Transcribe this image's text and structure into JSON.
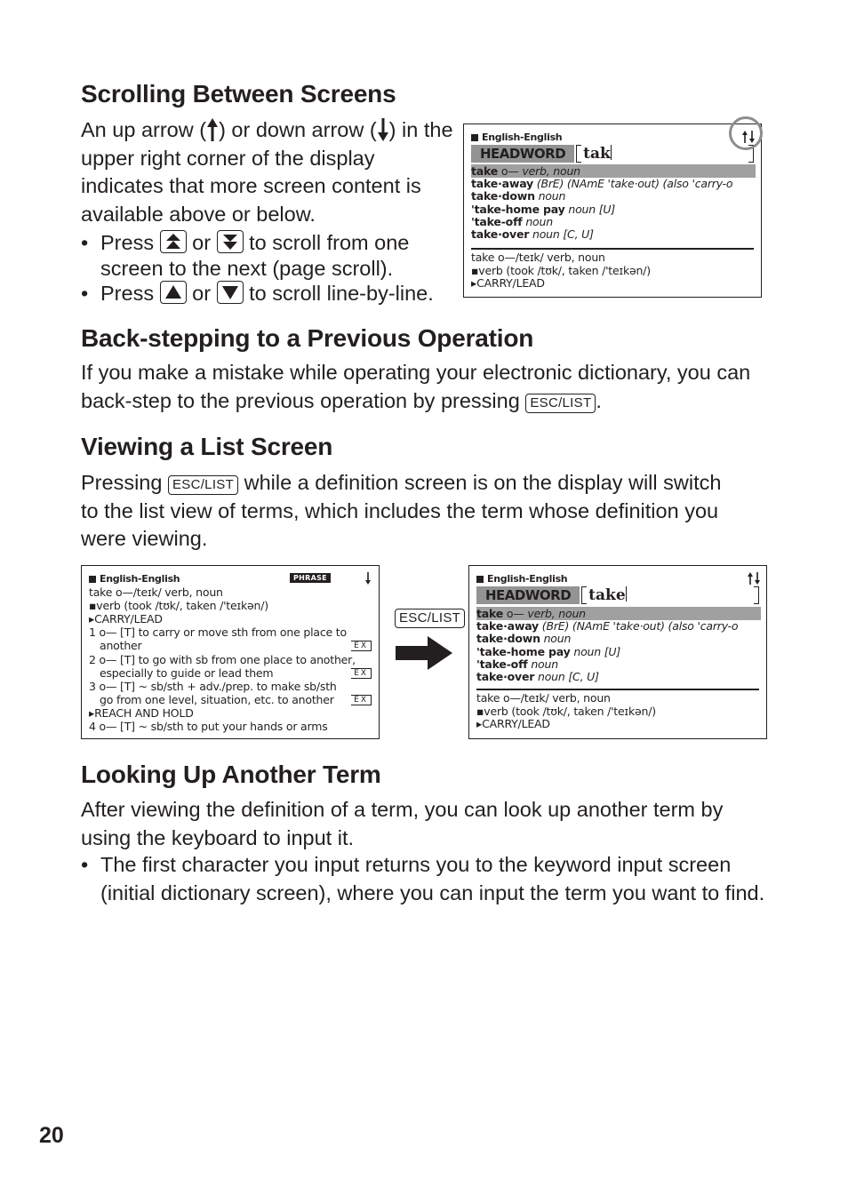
{
  "page_number": "20",
  "sections": {
    "scrolling": {
      "title": "Scrolling Between Screens",
      "para_parts": [
        "An up arrow (",
        ") or down arrow (",
        ") in the upper right corner of the display indicates that more screen content is available above or below."
      ],
      "bullets": [
        {
          "press": "Press",
          "or": "or",
          "text": "to scroll from one screen to the next (page scroll).",
          "keys": [
            "page-up-key",
            "page-down-key"
          ]
        },
        {
          "press": "Press",
          "or": "or",
          "text": "to scroll line-by-line.",
          "keys": [
            "up-key",
            "down-key"
          ]
        }
      ]
    },
    "backstep": {
      "title": "Back-stepping to a Previous Operation",
      "para_before": "If you make a mistake while operating your electronic dictionary, you can back-step to the previous operation by pressing",
      "para_after": "."
    },
    "list_screen": {
      "title": "Viewing a List Screen",
      "para_before": "Pressing",
      "para_after": "while a definition screen is on the display will switch to the list view of terms, which includes the term whose definition you were viewing."
    },
    "lookup": {
      "title": "Looking Up Another Term",
      "para": "After viewing the definition of a term, you can look up another term by using the keyboard to input it.",
      "bullet": "The first character you input returns you to the keyword input screen (initial dictionary screen), where you can input the term you want to find."
    }
  },
  "keys": {
    "esc_list": "ESC/LIST"
  },
  "screens": {
    "list1": {
      "header": "English-English",
      "headword_label": "HEADWORD",
      "input_value": "tak",
      "list": [
        {
          "head": "take",
          "key": "o—",
          "rest": "verb, noun",
          "selected": true
        },
        {
          "head": "take·away",
          "rest": "(BrE) (NAmE 'take·out) (also 'carry-o"
        },
        {
          "head": "take·down",
          "rest": "noun"
        },
        {
          "head": "'take-home pay",
          "rest": "noun [U]"
        },
        {
          "head": "'take-off",
          "rest": "noun"
        },
        {
          "head": "take·over",
          "rest": "noun [C, U]"
        }
      ],
      "preview": [
        "take o—/teɪk/ verb, noun",
        "▪verb (took /tʊk/, taken /'teɪkən/)",
        "▸CARRY/LEAD"
      ]
    },
    "definition": {
      "header": "English-English",
      "badge": "PHRASE",
      "lines": [
        "take o—/teɪk/ verb, noun",
        "▪verb (took /tʊk/, taken /'teɪkən/)",
        "▸CARRY/LEAD",
        "1 o— [T] to carry or move sth from one place to",
        "another",
        "2 o— [T] to go with sb from one place to another,",
        "especially to guide or lead them",
        "3 o— [T] ~ sb/sth + adv./prep. to make sb/sth",
        "go from one level, situation, etc. to another",
        "▸REACH AND HOLD",
        "4 o— [T] ~ sb/sth to put your hands or arms"
      ],
      "ex_label": "EX"
    },
    "list2": {
      "header": "English-English",
      "headword_label": "HEADWORD",
      "input_value": "take",
      "list": [
        {
          "head": "take",
          "key": "o—",
          "rest": "verb, noun",
          "selected": true
        },
        {
          "head": "take·away",
          "rest": "(BrE) (NAmE 'take·out) (also 'carry-o"
        },
        {
          "head": "take·down",
          "rest": "noun"
        },
        {
          "head": "'take-home pay",
          "rest": "noun [U]"
        },
        {
          "head": "'take-off",
          "rest": "noun"
        },
        {
          "head": "take·over",
          "rest": "noun [C, U]"
        }
      ],
      "preview": [
        "take o—/teɪk/ verb, noun",
        "▪verb (took /tʊk/, taken /'teɪkən/)",
        "▸CARRY/LEAD"
      ]
    }
  },
  "colors": {
    "text": "#231f20",
    "highlight": "#a0a0a0",
    "headword_bg": "#939393",
    "callout_circle": "#8c8c8c"
  }
}
